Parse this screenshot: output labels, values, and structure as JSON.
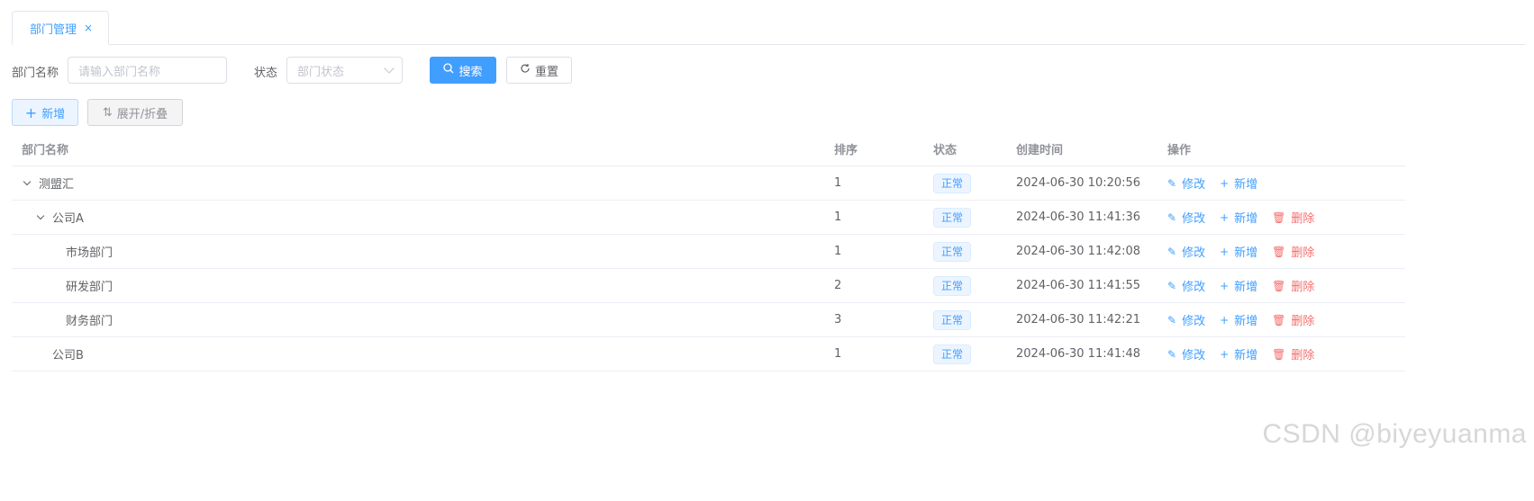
{
  "tab": {
    "label": "部门管理",
    "close": "×"
  },
  "search": {
    "dept_label": "部门名称",
    "dept_placeholder": "请输入部门名称",
    "status_label": "状态",
    "status_placeholder": "部门状态",
    "search_btn": "搜索",
    "reset_btn": "重置",
    "search_icon": "search-icon",
    "reset_icon": "refresh-icon"
  },
  "toolbar": {
    "add_btn": "新增",
    "expand_btn": "展开/折叠",
    "add_icon": "plus-icon",
    "expand_icon": "sort-icon"
  },
  "table": {
    "headers": {
      "name": "部门名称",
      "sort": "排序",
      "status": "状态",
      "time": "创建时间",
      "ops": "操作"
    },
    "rows": [
      {
        "name": "测盟汇",
        "sort": "1",
        "status": "正常",
        "time": "2024-06-30 10:20:56",
        "level": 0,
        "expandable": true,
        "ops": [
          "修改",
          "新增"
        ]
      },
      {
        "name": "公司A",
        "sort": "1",
        "status": "正常",
        "time": "2024-06-30 11:41:36",
        "level": 1,
        "expandable": true,
        "ops": [
          "修改",
          "新增",
          "删除"
        ]
      },
      {
        "name": "市场部门",
        "sort": "1",
        "status": "正常",
        "time": "2024-06-30 11:42:08",
        "level": 2,
        "expandable": false,
        "ops": [
          "修改",
          "新增",
          "删除"
        ]
      },
      {
        "name": "研发部门",
        "sort": "2",
        "status": "正常",
        "time": "2024-06-30 11:41:55",
        "level": 2,
        "expandable": false,
        "ops": [
          "修改",
          "新增",
          "删除"
        ]
      },
      {
        "name": "财务部门",
        "sort": "3",
        "status": "正常",
        "time": "2024-06-30 11:42:21",
        "level": 2,
        "expandable": false,
        "ops": [
          "修改",
          "新增",
          "删除"
        ]
      },
      {
        "name": "公司B",
        "sort": "1",
        "status": "正常",
        "time": "2024-06-30 11:41:48",
        "level": 1,
        "expandable": false,
        "ops": [
          "修改",
          "新增",
          "删除"
        ]
      }
    ]
  },
  "watermark": "CSDN @biyeyuanma",
  "colors": {
    "primary": "#409eff",
    "danger": "#f56c6c",
    "text": "#606266",
    "header_text": "#909399"
  }
}
